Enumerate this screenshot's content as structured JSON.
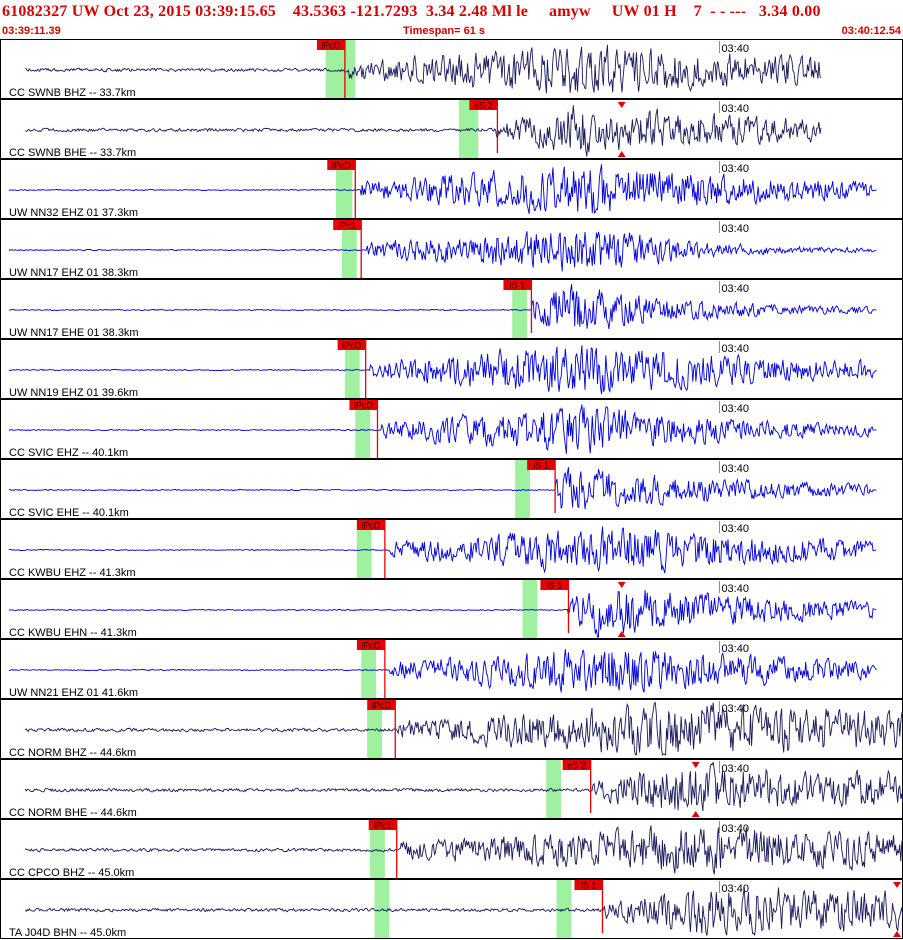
{
  "header": {
    "title": "61082327 UW Oct 23, 2015 03:39:15.65    43.5363 -121.7293  3.34 2.48 Ml le     amyw     UW 01 H    7  - - ---   3.34 0.00",
    "start_time": "03:39:11.39",
    "timespan": "Timespan=  61 s",
    "end_time": "03:40:12.54"
  },
  "colors": {
    "header_text": "#d60000",
    "pick_box": "#e60000",
    "green_band": "#9ff09f",
    "trace_navy": "#1a1a5c",
    "trace_blue": "#0000dd",
    "divider": "#000000"
  },
  "time_marker": "03:40",
  "channels": [
    {
      "label": "CC SWNB BHZ -- 33.7km",
      "pick": "iPcD",
      "pick_time": 23.3,
      "onset": 23.6,
      "green": [
        22.0,
        24.0
      ],
      "color": "navy",
      "amp": 24,
      "peak": 38.5,
      "decay": 22,
      "end": 55.5,
      "baseline": false,
      "pick_line_full": true
    },
    {
      "label": "CC SWNB BHE -- 33.7km",
      "pick": "eS 2",
      "pick_time": 33.6,
      "onset": 33.5,
      "green": [
        31.0,
        32.3
      ],
      "color": "navy",
      "amp": 22,
      "peak": 38.5,
      "decay": 20,
      "end": 55.5,
      "baseline": false,
      "pick_line_full": false,
      "triangle_time": 42.0
    },
    {
      "label": "UW NN32 EHZ 01 37.3km",
      "pick": "iPcD",
      "pick_time": 24.0,
      "onset": 24.4,
      "green": [
        22.7,
        23.8
      ],
      "color": "blue",
      "amp": 24,
      "peak": 40.0,
      "decay": 15,
      "end": 59,
      "baseline": true,
      "pick_line_full": true
    },
    {
      "label": "UW NN17 EHZ 01 38.3km",
      "pick": "iPc1",
      "pick_time": 24.4,
      "onset": 24.8,
      "green": [
        23.1,
        24.1
      ],
      "color": "blue",
      "amp": 22,
      "peak": 40.2,
      "decay": 6,
      "end": 59,
      "baseline": true,
      "pick_line_full": true
    },
    {
      "label": "UW NN17 EHE 01 38.3km",
      "pick": "iS 1",
      "pick_time": 35.9,
      "onset": 35.9,
      "green": [
        34.6,
        35.6
      ],
      "color": "blue",
      "amp": 24,
      "peak": 38.0,
      "decay": 8,
      "end": 59,
      "baseline": true,
      "pick_line_full": false
    },
    {
      "label": "UW NN19 EHZ 01 39.6km",
      "pick": "iPcD",
      "pick_time": 24.7,
      "onset": 25.0,
      "green": [
        23.3,
        24.3
      ],
      "color": "blue",
      "amp": 24,
      "peak": 38.5,
      "decay": 17,
      "end": 59,
      "baseline": true,
      "pick_line_full": true
    },
    {
      "label": "CC SVIC EHZ -- 40.1km",
      "pick": "iPcD",
      "pick_time": 25.5,
      "onset": 25.8,
      "green": [
        24.0,
        25.0
      ],
      "color": "blue",
      "amp": 22,
      "peak": 39.0,
      "decay": 12,
      "end": 59,
      "baseline": true,
      "pick_line_full": true
    },
    {
      "label": "CC SVIC EHE -- 40.1km",
      "pick": "iS 1",
      "pick_time": 37.5,
      "onset": 37.5,
      "green": [
        34.8,
        35.8
      ],
      "color": "blue",
      "amp": 22,
      "peak": 38.0,
      "decay": 12,
      "end": 59,
      "baseline": true,
      "pick_line_full": false
    },
    {
      "label": "CC KWBU EHZ -- 41.3km",
      "pick": "iPcD",
      "pick_time": 26.0,
      "onset": 26.3,
      "green": [
        24.1,
        25.1
      ],
      "color": "blue",
      "amp": 22,
      "peak": 42.0,
      "decay": 16,
      "end": 59,
      "baseline": true,
      "pick_line_full": true
    },
    {
      "label": "CC KWBU EHN -- 41.3km",
      "pick": "iS 1",
      "pick_time": 38.4,
      "onset": 38.4,
      "green": [
        35.3,
        36.3
      ],
      "color": "blue",
      "amp": 24,
      "peak": 40.0,
      "decay": 14,
      "end": 59,
      "baseline": true,
      "pick_line_full": false,
      "triangle_time": 42.0
    },
    {
      "label": "UW NN21 EHZ 01 41.6km",
      "pick": "iPcD",
      "pick_time": 26.0,
      "onset": 26.3,
      "green": [
        24.4,
        25.4
      ],
      "color": "blue",
      "amp": 22,
      "peak": 41.0,
      "decay": 16,
      "end": 59,
      "baseline": true,
      "pick_line_full": true
    },
    {
      "label": "CC NORM BHZ -- 44.6km",
      "pick": "iPcD",
      "pick_time": 26.7,
      "onset": 26.9,
      "green": [
        24.8,
        25.8
      ],
      "color": "navy",
      "amp": 24,
      "peak": 45.0,
      "decay": 40,
      "end": 61,
      "baseline": false,
      "pick_line_full": true
    },
    {
      "label": "CC NORM BHE -- 44.6km",
      "pick": "eS 2",
      "pick_time": 39.9,
      "onset": 40.0,
      "green": [
        36.9,
        37.9
      ],
      "color": "navy",
      "amp": 22,
      "peak": 45.0,
      "decay": 40,
      "end": 61,
      "baseline": false,
      "pick_line_full": false,
      "triangle_time": 47.0
    },
    {
      "label": "CC CPCO BHZ -- 45.0km",
      "pick": "iPc1",
      "pick_time": 26.8,
      "onset": 27.1,
      "green": [
        25.0,
        26.0
      ],
      "color": "navy",
      "amp": 22,
      "peak": 46.0,
      "decay": 30,
      "end": 61,
      "baseline": false,
      "pick_line_full": true
    },
    {
      "label": "TA J04D BHN -- 45.0km",
      "pick": "iS 1",
      "pick_time": 40.7,
      "onset": 40.8,
      "green": [
        25.3,
        26.3,
        37.6,
        38.6
      ],
      "color": "navy",
      "amp": 22,
      "peak": 47.0,
      "decay": 40,
      "end": 61,
      "baseline": false,
      "pick_line_full": false,
      "triangle_time": 62.6
    }
  ]
}
